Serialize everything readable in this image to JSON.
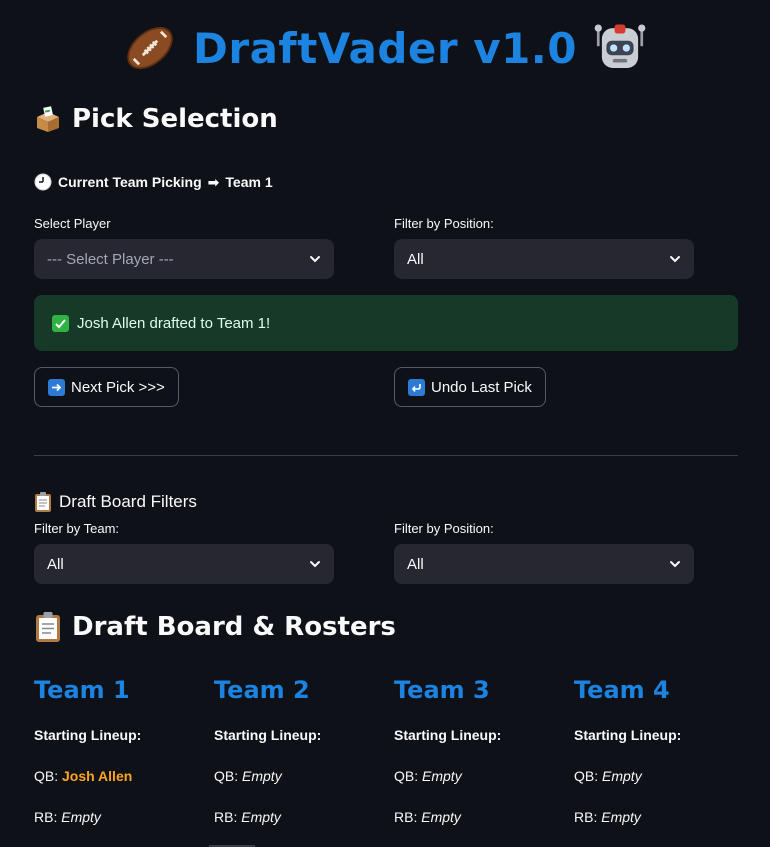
{
  "app": {
    "title": "DraftVader v1.0",
    "left_emoji": "football-icon",
    "right_emoji": "robot-icon"
  },
  "pick_selection": {
    "heading": "Pick Selection",
    "current_team_label": "Current Team Picking",
    "current_team_value": "Team 1",
    "select_player_label": "Select Player",
    "select_player_value": "--- Select Player ---",
    "filter_position_label": "Filter by Position:",
    "filter_position_value": "All",
    "success_message": "Josh Allen drafted to Team 1!",
    "next_pick_label": "Next Pick >>>",
    "undo_label": "Undo Last Pick"
  },
  "board_filters": {
    "heading": "Draft Board Filters",
    "team_label": "Filter by Team:",
    "team_value": "All",
    "position_label": "Filter by Position:",
    "position_value": "All"
  },
  "board": {
    "heading": "Draft Board & Rosters",
    "lineup_label": "Starting Lineup:",
    "teams": [
      {
        "name": "Team 1",
        "qb_label": "QB:",
        "qb": "Josh Allen",
        "rb_label": "RB:",
        "rb": "Empty"
      },
      {
        "name": "Team 2",
        "qb_label": "QB:",
        "qb": "Empty",
        "rb_label": "RB:",
        "rb": "Empty"
      },
      {
        "name": "Team 3",
        "qb_label": "QB:",
        "qb": "Empty",
        "rb_label": "RB:",
        "rb": "Empty"
      },
      {
        "name": "Team 4",
        "qb_label": "QB:",
        "qb": "Empty",
        "rb_label": "RB:",
        "rb": "Empty"
      }
    ]
  },
  "colors": {
    "background": "#0e1117",
    "accent_blue": "#1c83e1",
    "input_bg": "#262730",
    "success_bg": "#173928",
    "drafted_orange": "#ffa421"
  }
}
